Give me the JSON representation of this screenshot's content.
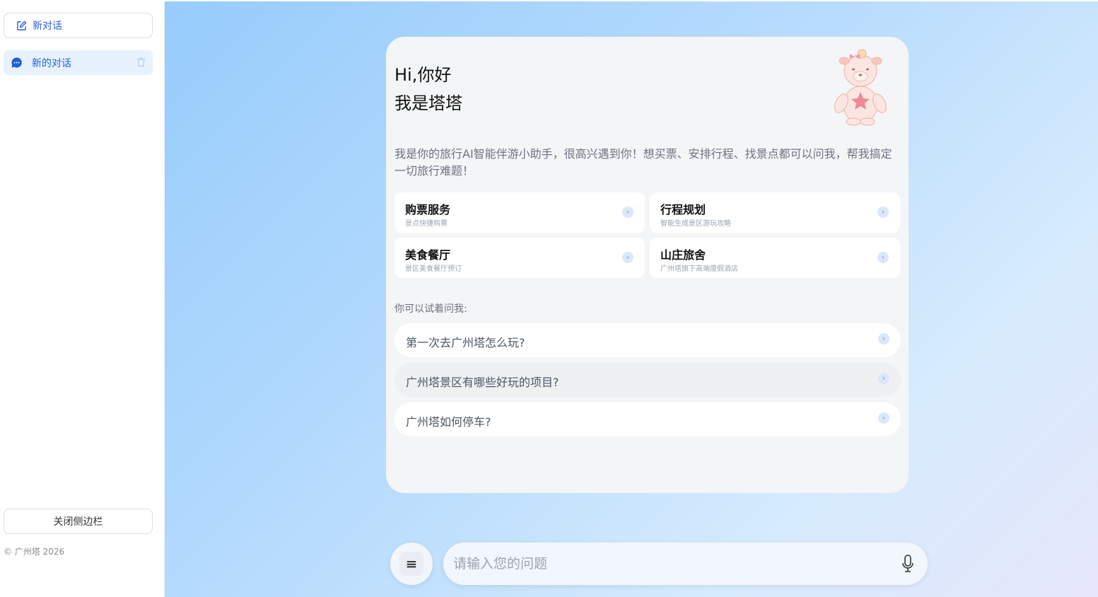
{
  "sidebar": {
    "new_chat_label": "新对话",
    "conversations": [
      {
        "label": "新的对话"
      }
    ],
    "close_label": "关闭侧边栏",
    "copyright": "© 广州塔 2026"
  },
  "welcome": {
    "line1": "Hi,你好",
    "line2": "我是塔塔",
    "intro": "我是你的旅行AI智能伴游小助手，很高兴遇到你！想买票、安排行程、找景点都可以问我，帮我搞定一切旅行难题！"
  },
  "services": [
    {
      "title": "购票服务",
      "subtitle": "景点快捷购票"
    },
    {
      "title": "行程规划",
      "subtitle": "智能生成景区游玩攻略"
    },
    {
      "title": "美食餐厅",
      "subtitle": "景区美食餐厅预订"
    },
    {
      "title": "山庄旅舍",
      "subtitle": "广州塔旗下高端度假酒店"
    }
  ],
  "suggestions": {
    "label": "你可以试着问我:",
    "items": [
      "第一次去广州塔怎么玩?",
      "广州塔景区有哪些好玩的项目?",
      "广州塔如何停车?"
    ]
  },
  "input": {
    "placeholder": "请输入您的问题"
  },
  "colors": {
    "accent": "#1f5fd6",
    "active_bg": "#e8f2fd",
    "card_bg": "#f4f5f7"
  },
  "icons": {
    "new_chat": "edit-icon",
    "conversation": "chat-bubble-icon",
    "delete": "trash-icon",
    "menu": "menu-icon",
    "mic": "microphone-icon",
    "chevron": "chevron-right-icon"
  }
}
